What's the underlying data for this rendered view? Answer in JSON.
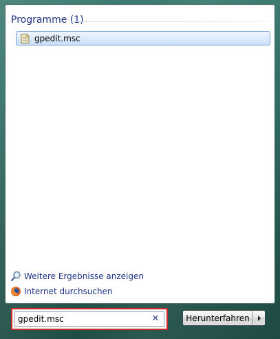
{
  "results": {
    "section_title": "Programme (1)",
    "items": [
      {
        "label": "gpedit.msc",
        "icon": "msc-document-icon"
      }
    ]
  },
  "links": {
    "more_results": {
      "label": "Weitere Ergebnisse anzeigen",
      "icon": "search-icon"
    },
    "internet_search": {
      "label": "Internet durchsuchen",
      "icon": "firefox-icon"
    }
  },
  "search": {
    "value": "gpedit.msc",
    "clear_icon": "close-icon",
    "highlight_color": "#d22a2a"
  },
  "shutdown": {
    "label": "Herunterfahren",
    "arrow_icon": "chevron-right-icon"
  },
  "colors": {
    "link_text": "#1e3287",
    "selected_item_border": "#7da2ce",
    "frame": "#2d6a62"
  }
}
